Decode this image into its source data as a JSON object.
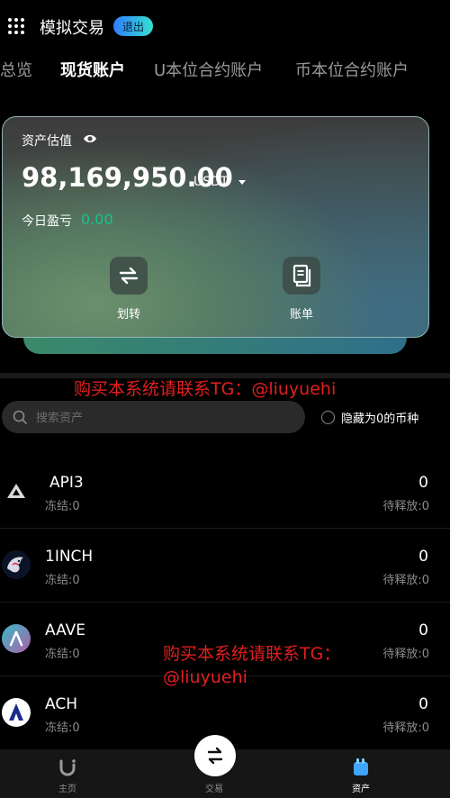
{
  "header": {
    "title": "模拟交易",
    "logout_label": "退出"
  },
  "tabs": [
    {
      "label": "总览",
      "active": false
    },
    {
      "label": "现货账户",
      "active": true
    },
    {
      "label": "U本位合约账户",
      "active": false
    },
    {
      "label": "币本位合约账户",
      "active": false
    }
  ],
  "asset_card": {
    "estimate_label": "资产估值",
    "balance": "98,169,950.00",
    "currency": "USDT",
    "pnl_label": "今日盈亏",
    "pnl_value": "0.00",
    "transfer_label": "划转",
    "bill_label": "账单"
  },
  "watermark": {
    "line1": "购买本系统请联系TG：@liuyuehi",
    "line2": "购买本系统请联系TG：@liuyuehi"
  },
  "search": {
    "placeholder": "搜索资产"
  },
  "hide_zero_label": "隐藏为0的币种",
  "coins": [
    {
      "name": "API3",
      "frozen": "冻结:0",
      "amount": "0",
      "pending": "待释放:0",
      "icon": "api3-icon"
    },
    {
      "name": "1INCH",
      "frozen": "冻结:0",
      "amount": "0",
      "pending": "待释放:0",
      "icon": "1inch-icon"
    },
    {
      "name": "AAVE",
      "frozen": "冻结:0",
      "amount": "0",
      "pending": "待释放:0",
      "icon": "aave-icon"
    },
    {
      "name": "ACH",
      "frozen": "冻结:0",
      "amount": "0",
      "pending": "待释放:0",
      "icon": "ach-icon"
    }
  ],
  "bottom_nav": {
    "home": "主页",
    "trade": "交易",
    "assets": "资产"
  },
  "colors": {
    "accent_green": "#19c38a",
    "watermark_red": "#e21e1e",
    "logout_gradient_start": "#2f7dff",
    "logout_gradient_end": "#35e0d0"
  }
}
